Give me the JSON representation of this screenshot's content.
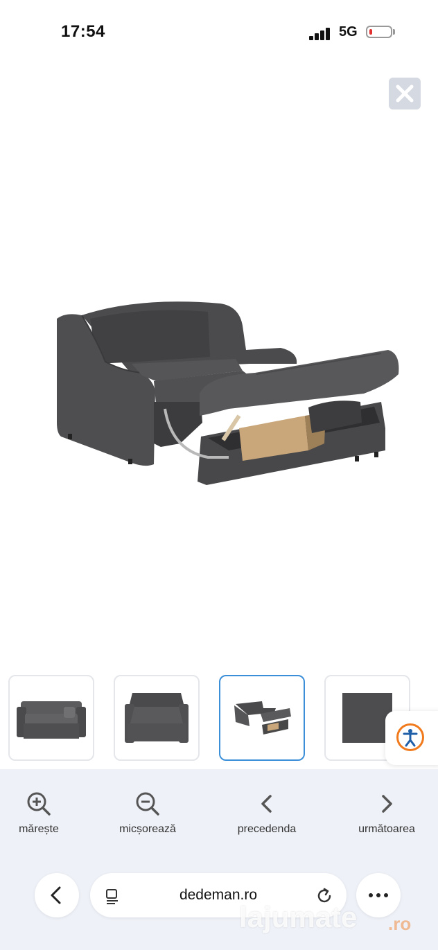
{
  "status_bar": {
    "time": "17:54",
    "network": "5G"
  },
  "viewer": {
    "image_subject": "grey sofa bed with open storage drawer"
  },
  "thumbnails": [
    {
      "label": "sofa front view"
    },
    {
      "label": "sofa extended bed"
    },
    {
      "label": "sofa with open storage",
      "active": true
    },
    {
      "label": "fabric swatch"
    }
  ],
  "toolbar": {
    "zoom_in": "mărește",
    "zoom_out": "micșorează",
    "previous": "precedenda",
    "next": "următoarea"
  },
  "browser": {
    "url": "dedeman.ro"
  },
  "watermark": {
    "text": "lajumate",
    "suffix": ".ro"
  },
  "colors": {
    "accent": "#3b8fd9",
    "accessibility": "#f07a1c",
    "toolbar_bg": "#eef1f7",
    "sofa": "#4a4a4c"
  }
}
